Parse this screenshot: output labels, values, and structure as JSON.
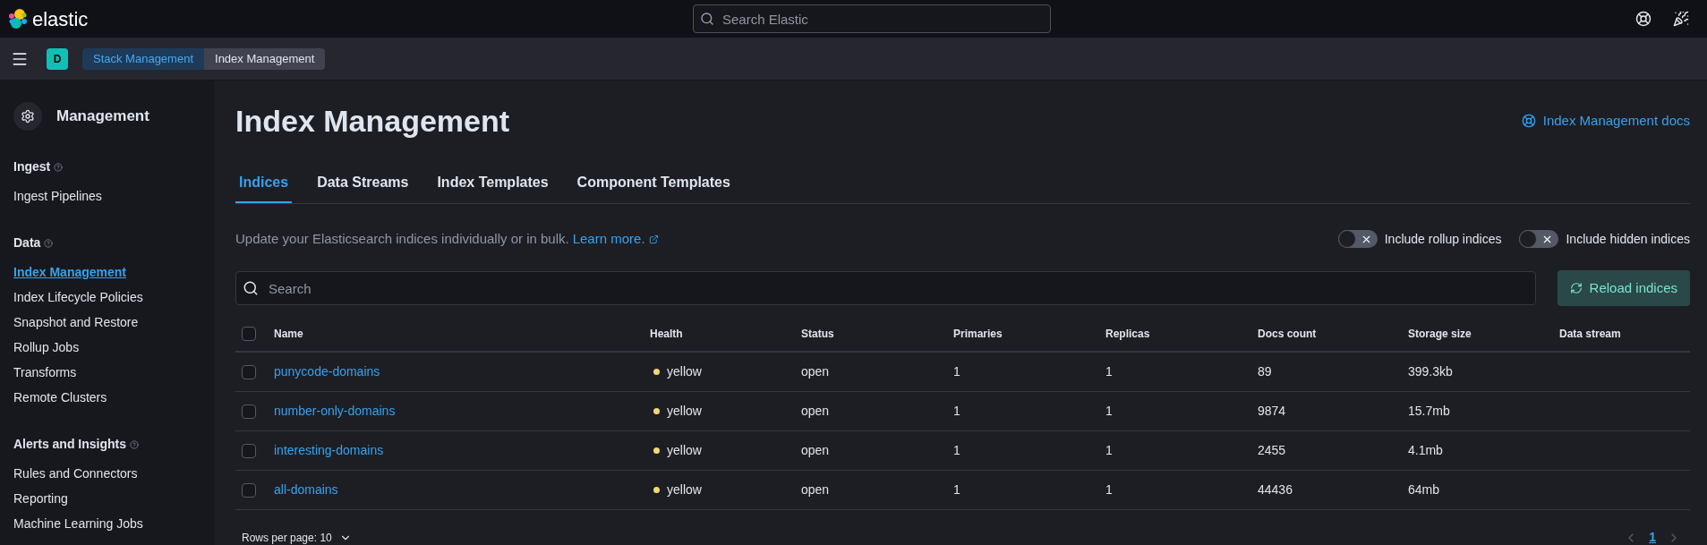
{
  "header": {
    "logo_text": "elastic",
    "search": {
      "placeholder": "Search Elastic"
    }
  },
  "breadcrumb_bar": {
    "space_badge": "D",
    "breadcrumbs": [
      {
        "label": "Stack Management",
        "selected": false
      },
      {
        "label": "Index Management",
        "selected": true
      }
    ]
  },
  "sidebar": {
    "title": "Management",
    "groups": [
      {
        "title": "Ingest",
        "items": [
          {
            "label": "Ingest Pipelines",
            "selected": false
          }
        ]
      },
      {
        "title": "Data",
        "items": [
          {
            "label": "Index Management",
            "selected": true
          },
          {
            "label": "Index Lifecycle Policies",
            "selected": false
          },
          {
            "label": "Snapshot and Restore",
            "selected": false
          },
          {
            "label": "Rollup Jobs",
            "selected": false
          },
          {
            "label": "Transforms",
            "selected": false
          },
          {
            "label": "Remote Clusters",
            "selected": false
          }
        ]
      },
      {
        "title": "Alerts and Insights",
        "items": [
          {
            "label": "Rules and Connectors",
            "selected": false
          },
          {
            "label": "Reporting",
            "selected": false
          },
          {
            "label": "Machine Learning Jobs",
            "selected": false
          }
        ]
      }
    ]
  },
  "page": {
    "title": "Index Management",
    "docs_link": "Index Management docs",
    "tabs": [
      {
        "label": "Indices",
        "selected": true
      },
      {
        "label": "Data Streams",
        "selected": false
      },
      {
        "label": "Index Templates",
        "selected": false
      },
      {
        "label": "Component Templates",
        "selected": false
      }
    ],
    "description": "Update your Elasticsearch indices individually or in bulk.",
    "learn_more": "Learn more.",
    "toggles": [
      {
        "label": "Include rollup indices",
        "checked": false
      },
      {
        "label": "Include hidden indices",
        "checked": false
      }
    ],
    "search": {
      "placeholder": "Search"
    },
    "reload_button": "Reload indices"
  },
  "table": {
    "select_all_checked": false,
    "columns": [
      "Name",
      "Health",
      "Status",
      "Primaries",
      "Replicas",
      "Docs count",
      "Storage size",
      "Data stream"
    ],
    "rows": [
      {
        "checked": false,
        "name": "punycode-domains",
        "health": "yellow",
        "color": "#f1d86f",
        "status": "open",
        "primaries": "1",
        "replicas": "1",
        "docs_count": "89",
        "storage_size": "399.3kb"
      },
      {
        "checked": false,
        "name": "number-only-domains",
        "health": "yellow",
        "color": "#f1d86f",
        "status": "open",
        "primaries": "1",
        "replicas": "1",
        "docs_count": "9874",
        "storage_size": "15.7mb"
      },
      {
        "checked": false,
        "name": "interesting-domains",
        "health": "yellow",
        "color": "#f1d86f",
        "status": "open",
        "primaries": "1",
        "replicas": "1",
        "docs_count": "2455",
        "storage_size": "4.1mb"
      },
      {
        "checked": false,
        "name": "all-domains",
        "health": "yellow",
        "color": "#f1d86f",
        "status": "open",
        "primaries": "1",
        "replicas": "1",
        "docs_count": "44436",
        "storage_size": "64mb"
      }
    ]
  },
  "pagination": {
    "rows_per_page": "Rows per page: 10",
    "pages": [
      {
        "label": "1",
        "selected": true
      }
    ]
  }
}
